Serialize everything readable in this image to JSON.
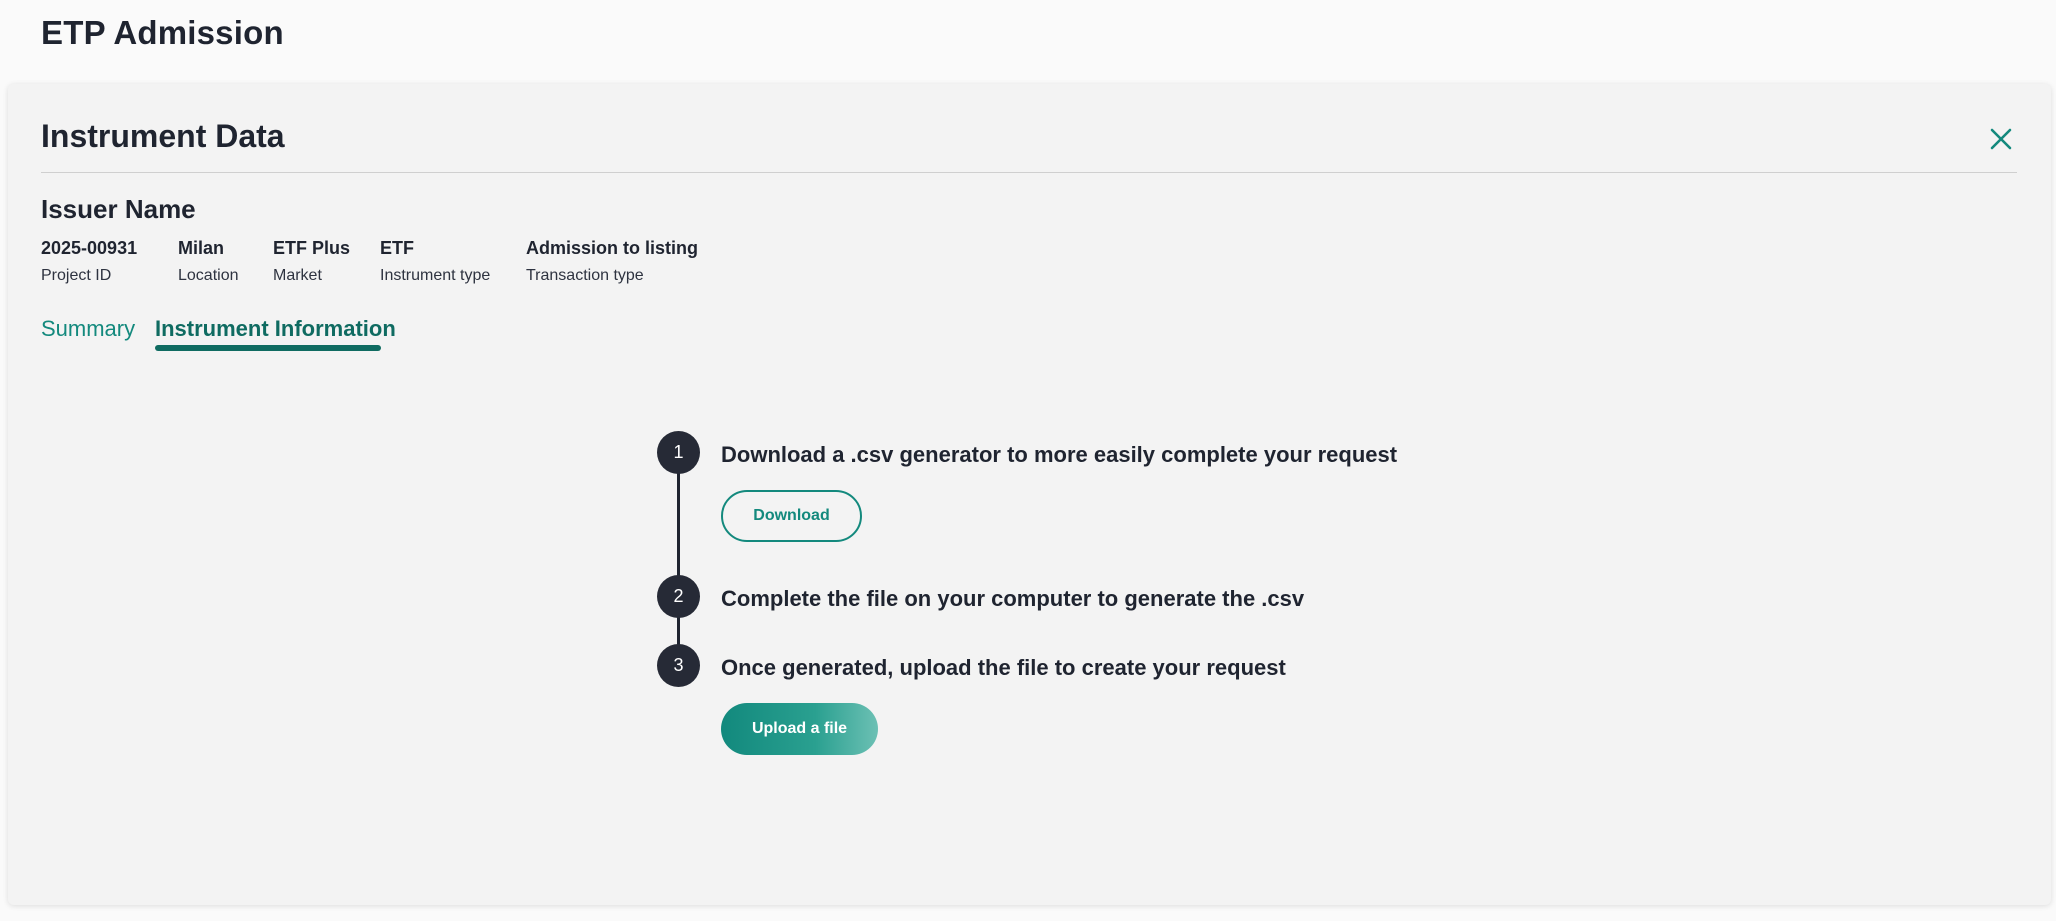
{
  "app": {
    "title": "ETP Admission"
  },
  "panel": {
    "title": "Instrument Data",
    "issuer_name": "Issuer Name",
    "meta": [
      {
        "value": "2025-00931",
        "label": "Project ID"
      },
      {
        "value": "Milan",
        "label": "Location"
      },
      {
        "value": "ETF Plus",
        "label": "Market"
      },
      {
        "value": "ETF",
        "label": "Instrument type"
      },
      {
        "value": "Admission to listing",
        "label": "Transaction type"
      }
    ],
    "tabs": [
      {
        "label": "Summary",
        "active": false
      },
      {
        "label": "Instrument Information",
        "active": true
      }
    ]
  },
  "steps": [
    {
      "number": "1",
      "text": "Download a .csv generator to more easily complete your request",
      "button": "Download"
    },
    {
      "number": "2",
      "text": "Complete the file on your computer to generate the .csv"
    },
    {
      "number": "3",
      "text": "Once generated, upload the file to create your request",
      "button": "Upload a file"
    }
  ],
  "colors": {
    "accent": "#13897d",
    "accent_dark": "#0f6b61",
    "text": "#1f2430",
    "step_circle": "#262a36",
    "panel_bg": "#f3f3f3"
  },
  "icons": {
    "close": "close-icon"
  }
}
